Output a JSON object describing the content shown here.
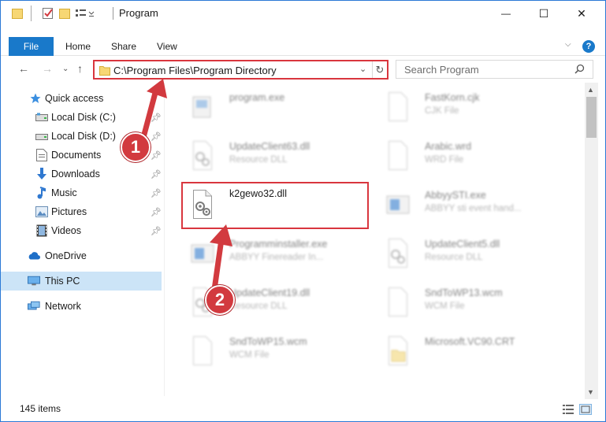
{
  "window": {
    "title": "Program",
    "controls": {
      "minimize": "—",
      "maximize": "☐",
      "close": "✕"
    }
  },
  "ribbon": {
    "tabs": [
      {
        "label": "File"
      },
      {
        "label": "Home"
      },
      {
        "label": "Share"
      },
      {
        "label": "View"
      }
    ],
    "help": "?"
  },
  "navigation": {
    "address_path": "C:\\Program Files\\Program Directory",
    "search_placeholder": "Search Program"
  },
  "sidebar": {
    "items": [
      {
        "label": "Quick access",
        "icon": "star-icon",
        "pinned": false
      },
      {
        "label": "Local Disk (C:)",
        "icon": "drive-icon",
        "pinned": true
      },
      {
        "label": "Local Disk (D:)",
        "icon": "drive-icon",
        "pinned": true
      },
      {
        "label": "Documents",
        "icon": "documents-icon",
        "pinned": true
      },
      {
        "label": "Downloads",
        "icon": "download-icon",
        "pinned": true
      },
      {
        "label": "Music",
        "icon": "music-icon",
        "pinned": true
      },
      {
        "label": "Pictures",
        "icon": "pictures-icon",
        "pinned": true
      },
      {
        "label": "Videos",
        "icon": "videos-icon",
        "pinned": true
      },
      {
        "label": "OneDrive",
        "icon": "cloud-icon",
        "pinned": false
      },
      {
        "label": "This PC",
        "icon": "computer-icon",
        "pinned": false,
        "selected": true
      },
      {
        "label": "Network",
        "icon": "network-icon",
        "pinned": false
      }
    ]
  },
  "files": [
    {
      "name": "program.exe",
      "type": "",
      "icon": "exe-icon"
    },
    {
      "name": "FastKorn.cjk",
      "type": "CJK File",
      "icon": "blank-file-icon"
    },
    {
      "name": "UpdateClient63.dll",
      "type": "Resource DLL",
      "icon": "dll-icon"
    },
    {
      "name": "Arabic.wrd",
      "type": "WRD File",
      "icon": "blank-file-icon"
    },
    {
      "name": "k2gewo32.dll",
      "type": "",
      "icon": "dll-icon"
    },
    {
      "name": "AbbyySTI.exe",
      "type": "ABBYY sti event hand...",
      "icon": "app-icon"
    },
    {
      "name": "Programminstaller.exe",
      "type": "ABBYY Finereader In...",
      "icon": "app-icon"
    },
    {
      "name": "UpdateClient5.dll",
      "type": "Resource DLL",
      "icon": "dll-icon"
    },
    {
      "name": "UpdateClient19.dll",
      "type": "Resource DLL",
      "icon": "dll-icon"
    },
    {
      "name": "SndToWP13.wcm",
      "type": "WCM File",
      "icon": "blank-file-icon"
    },
    {
      "name": "SndToWP15.wcm",
      "type": "WCM File",
      "icon": "blank-file-icon"
    },
    {
      "name": "Microsoft.VC90.CRT",
      "type": "",
      "icon": "folder-icon"
    }
  ],
  "status": {
    "item_count": "145 items"
  },
  "annotations": [
    {
      "number": "1"
    },
    {
      "number": "2"
    }
  ],
  "colors": {
    "accent": "#1979ca",
    "highlight": "#d9363e",
    "selected_bg": "#cce4f7",
    "callout": "#d23a3f"
  }
}
